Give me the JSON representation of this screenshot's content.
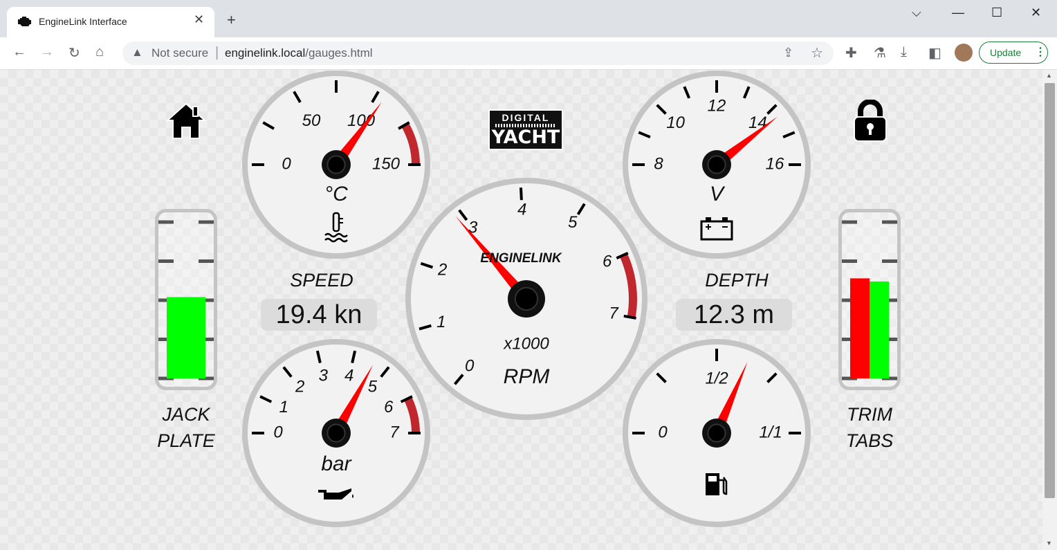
{
  "browser": {
    "tab_title": "EngineLink Interface",
    "new_tab": "+",
    "security_label": "Not secure",
    "url_host": "enginelink.local",
    "url_path": "/gauges.html",
    "update_label": "Update"
  },
  "colors": {
    "needle": "#ff0000",
    "redzone": "#c0282d",
    "bar_green": "#00ff00",
    "bar_red": "#ff0000",
    "bezel": "#c4c4c4",
    "face": "#f2f2f2"
  },
  "logo": {
    "line1": "DIGITAL",
    "line2": "YACHT"
  },
  "icons": {
    "home": "home-icon",
    "lock": "lock-icon",
    "temp": "thermometer-water-icon",
    "oil": "oil-can-icon",
    "battery": "battery-icon",
    "fuel": "fuel-pump-icon"
  },
  "gauges": {
    "temp": {
      "unit": "°C",
      "labels": [
        "0",
        "50",
        "100",
        "150"
      ],
      "value": 105
    },
    "oil": {
      "unit": "bar",
      "labels": [
        "0",
        "1",
        "2",
        "3",
        "4",
        "5",
        "6",
        "7"
      ],
      "value": 4.6
    },
    "rpm": {
      "unit": "RPM",
      "multiplier": "x1000",
      "brand": "ENGINELINK",
      "labels": [
        "0",
        "1",
        "2",
        "3",
        "4",
        "5",
        "6",
        "7"
      ],
      "value": 2.9
    },
    "volt": {
      "unit": "V",
      "labels": [
        "8",
        "10",
        "12",
        "14",
        "16"
      ],
      "value": 14.3
    },
    "fuel": {
      "labels": [
        "0",
        "1/2",
        "1/1"
      ],
      "value": 0.63
    }
  },
  "speed": {
    "label": "SPEED",
    "value": "19.4 kn"
  },
  "depth": {
    "label": "DEPTH",
    "value": "12.3 m"
  },
  "jack_plate": {
    "label_line1": "JACK",
    "label_line2": "PLATE",
    "level": 0.52
  },
  "trim_tabs": {
    "label_line1": "TRIM",
    "label_line2": "TABS",
    "left_level": 0.64,
    "right_level": 0.62
  }
}
